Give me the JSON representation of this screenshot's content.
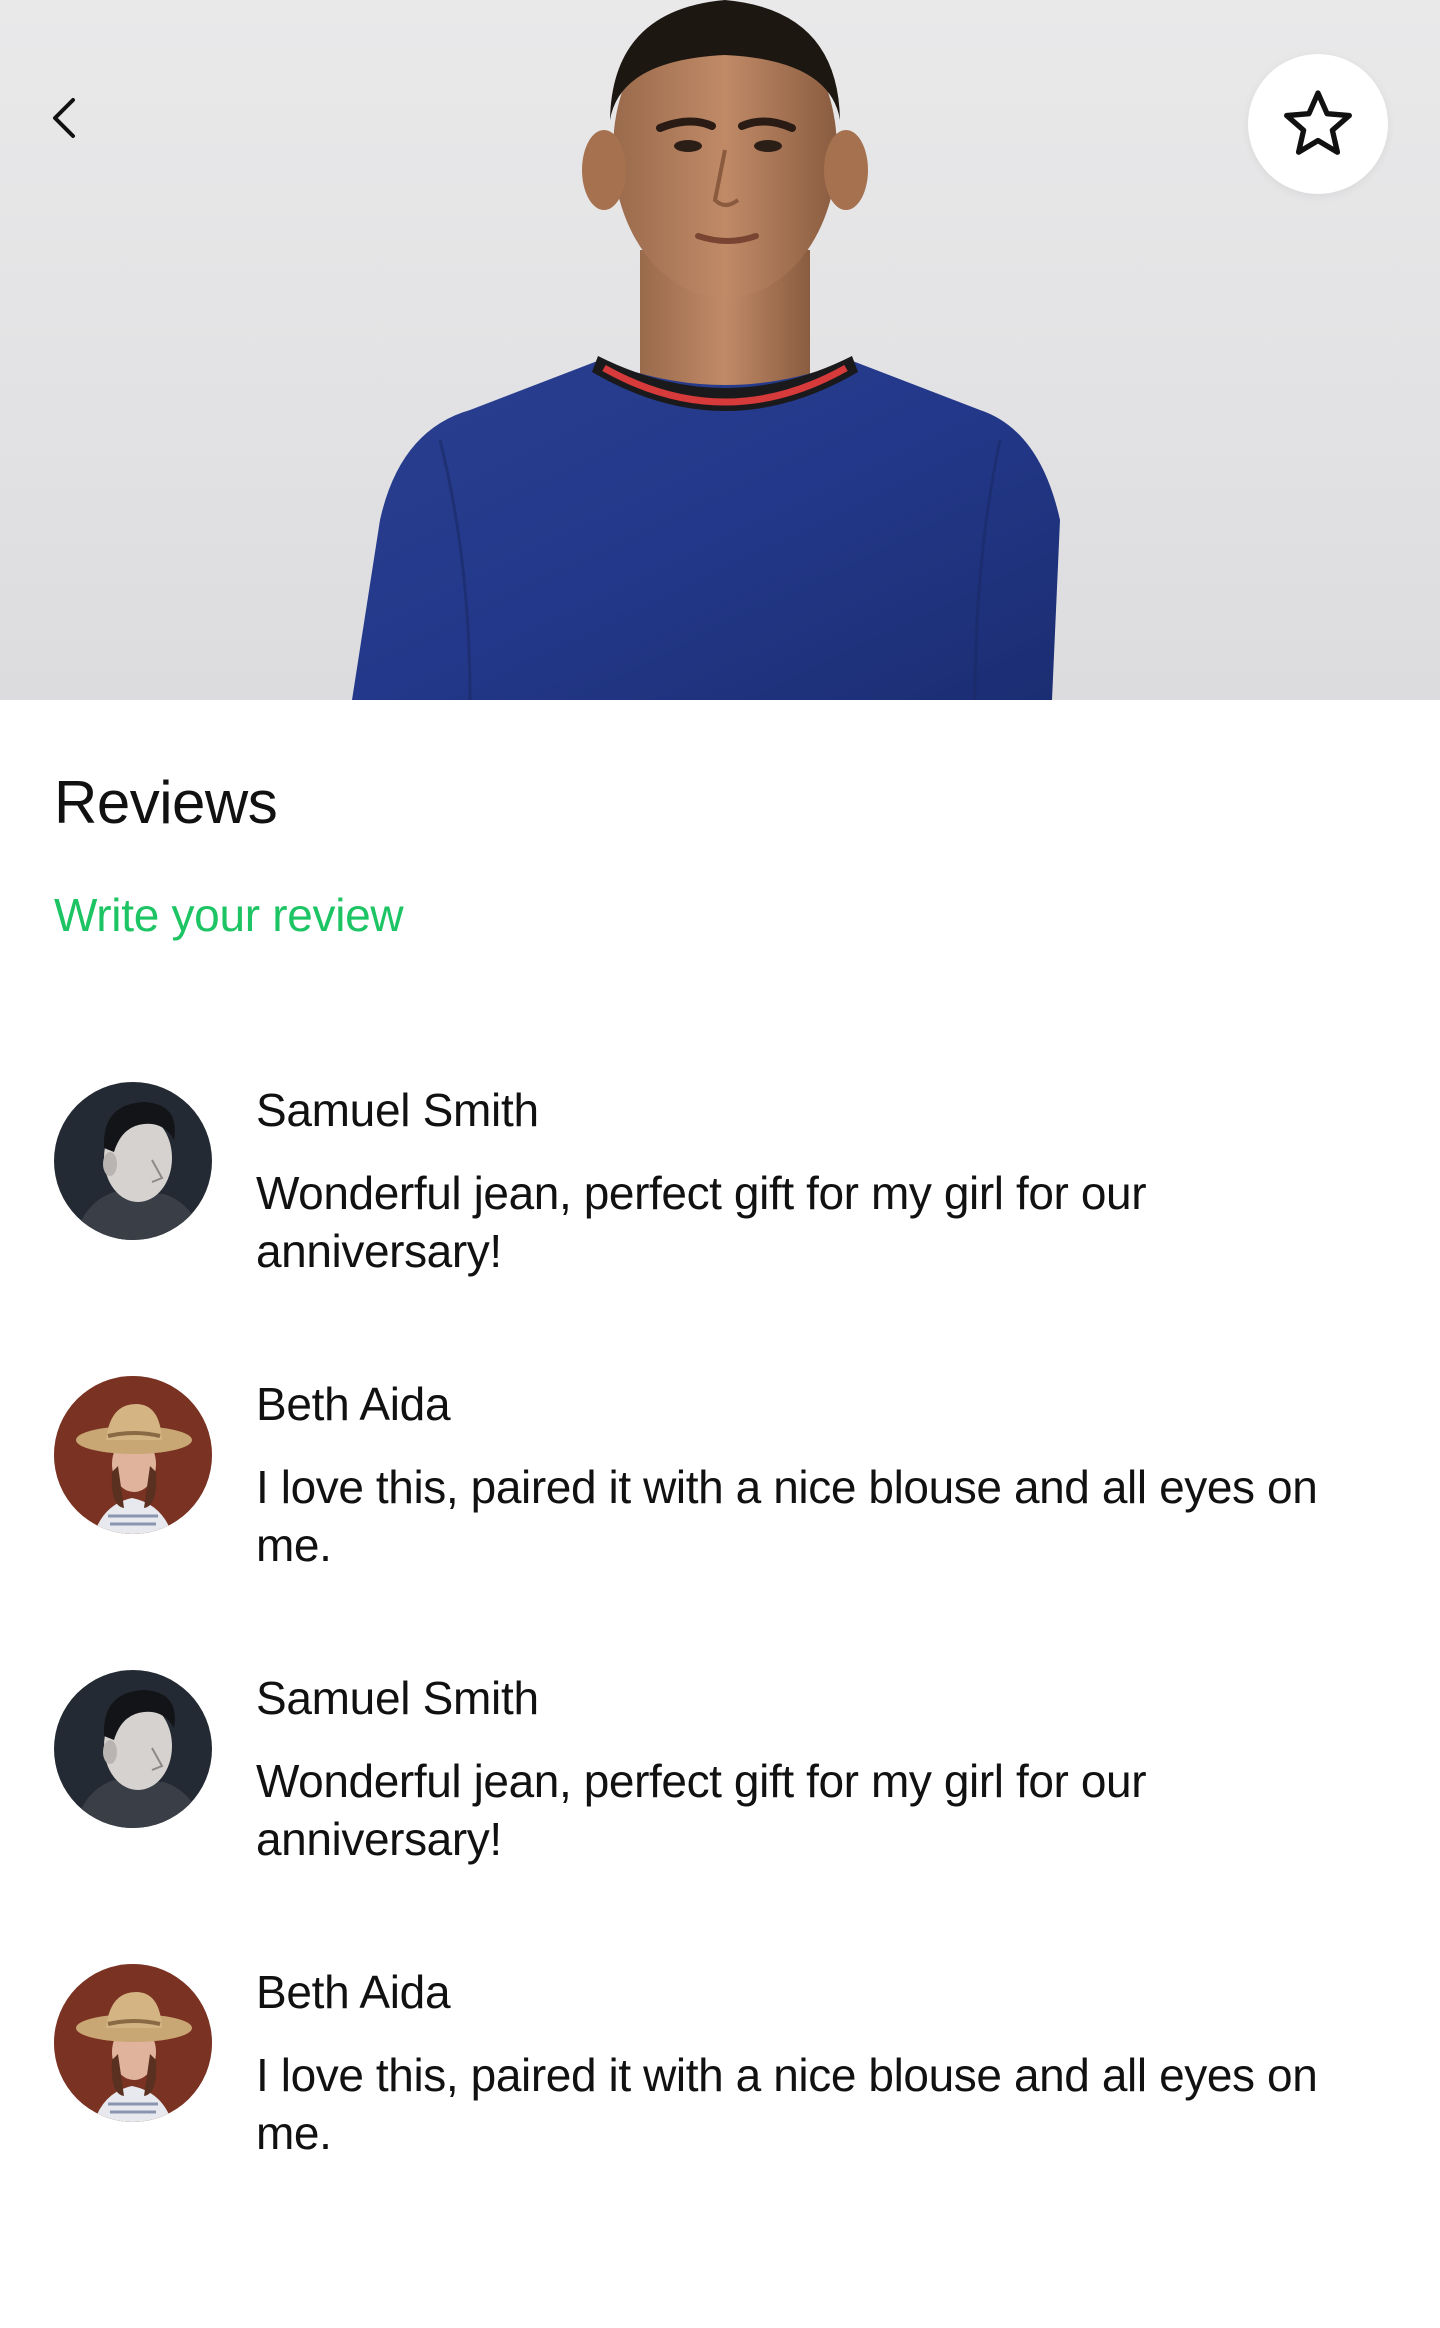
{
  "header": {
    "back_icon": "chevron-left-icon",
    "favorite_icon": "star-outline-icon"
  },
  "reviews": {
    "title": "Reviews",
    "write_review_label": "Write your review",
    "accent_color": "#1dc464",
    "items": [
      {
        "name": "Samuel Smith",
        "text": "Wonderful jean, perfect gift for my girl for our anniversary!",
        "avatar": "man-portrait-avatar"
      },
      {
        "name": "Beth Aida",
        "text": "I love this, paired it with a nice blouse and all eyes on me.",
        "avatar": "woman-with-hat-avatar"
      },
      {
        "name": "Samuel Smith",
        "text": "Wonderful jean, perfect gift for my girl for our anniversary!",
        "avatar": "man-portrait-avatar"
      },
      {
        "name": "Beth Aida",
        "text": "I love this, paired it with a nice blouse and all eyes on me.",
        "avatar": "woman-with-hat-avatar"
      }
    ]
  }
}
